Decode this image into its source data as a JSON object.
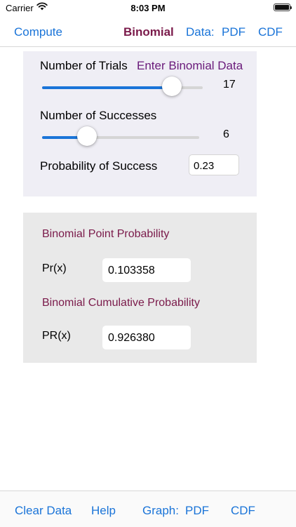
{
  "status": {
    "carrier": "Carrier",
    "time": "8:03 PM"
  },
  "nav": {
    "compute": "Compute",
    "title": "Binomial",
    "data_label": "Data:",
    "pdf": "PDF",
    "cdf": "CDF"
  },
  "inputs": {
    "trials_label": "Number of Trials",
    "hint": "Enter Binomial Data",
    "trials_value": "17",
    "trials_fraction": 0.81,
    "successes_label": "Number of Successes",
    "successes_value": "6",
    "successes_fraction": 0.29,
    "prob_label": "Probability of Success",
    "prob_value": "0.23"
  },
  "results": {
    "point_title": "Binomial Point Probability",
    "point_label": "Pr(x)",
    "point_value": "0.103358",
    "cum_title": "Binomial Cumulative Probability",
    "cum_label": "PR(x)",
    "cum_value": "0.926380"
  },
  "toolbar": {
    "clear": "Clear Data",
    "help": "Help",
    "graph": "Graph:",
    "pdf": "PDF",
    "cdf": "CDF"
  },
  "colors": {
    "accent": "#1a74d8",
    "title": "#7a1a4a"
  },
  "icons": [
    "wifi-icon",
    "battery-icon"
  ]
}
